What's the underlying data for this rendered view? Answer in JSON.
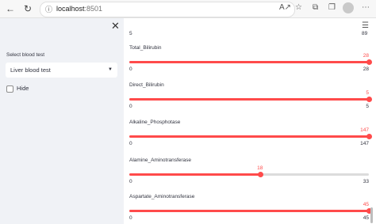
{
  "browser": {
    "url_host": "localhost",
    "url_port": ":8501"
  },
  "sidebar": {
    "select_label": "Select blood test",
    "select_value": "Liver blood test",
    "checkbox_label": "Hide"
  },
  "main": {
    "top_range": {
      "min": "5",
      "max": "89"
    },
    "sliders": [
      {
        "label": "Total_Bilirubin",
        "min": 0,
        "max": 28,
        "value": 28,
        "min_text": "0",
        "max_text": "28",
        "value_text": "28"
      },
      {
        "label": "Direct_Bilirubin",
        "min": 0,
        "max": 5,
        "value": 5,
        "min_text": "0",
        "max_text": "5",
        "value_text": "5"
      },
      {
        "label": "Alkaline_Phosphotase",
        "min": 0,
        "max": 147,
        "value": 147,
        "min_text": "0",
        "max_text": "147",
        "value_text": "147"
      },
      {
        "label": "Alamine_Aminotransferase",
        "min": 0,
        "max": 33,
        "value": 18,
        "min_text": "0",
        "max_text": "33",
        "value_text": "18"
      },
      {
        "label": "Aspartate_Aminotransferase",
        "min": 0,
        "max": 45,
        "value": 45,
        "min_text": "0",
        "max_text": "45",
        "value_text": "45"
      }
    ]
  },
  "colors": {
    "accent": "#ff4b4b",
    "sidebar_bg": "#f0f2f6"
  }
}
